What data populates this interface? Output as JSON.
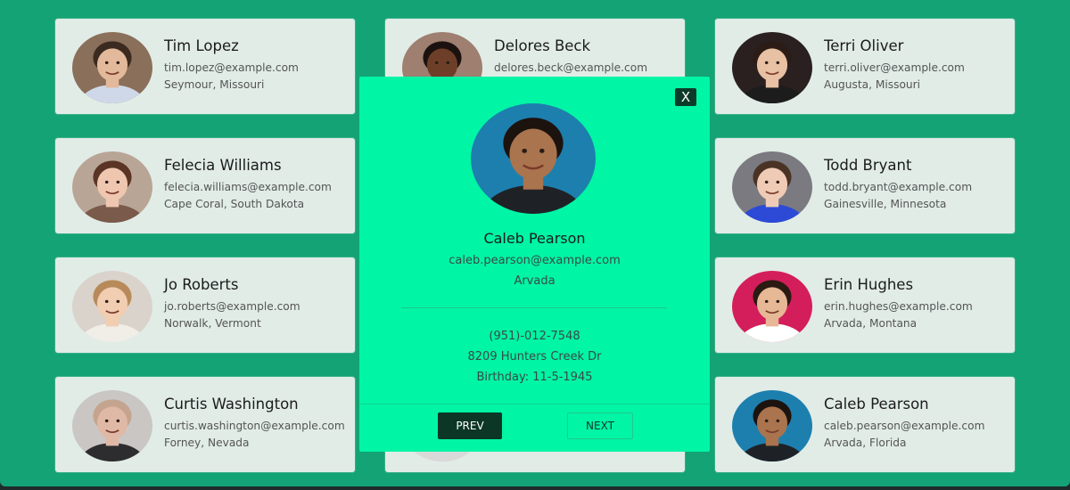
{
  "cards": [
    {
      "name": "Tim Lopez",
      "email": "tim.lopez@example.com",
      "location": "Seymour, Missouri",
      "skin": "#e2b99a",
      "hair": "#3b2a1f",
      "bg": "#8a6f5a",
      "shirt": "#cfd8e8"
    },
    {
      "name": "Delores Beck",
      "email": "delores.beck@example.com",
      "location": "",
      "skin": "#6e3f28",
      "hair": "#1b1210",
      "bg": "#9e7f70",
      "shirt": "#2b2b2b"
    },
    {
      "name": "Terri Oliver",
      "email": "terri.oliver@example.com",
      "location": "Augusta, Missouri",
      "skin": "#e8c0a4",
      "hair": "#2b1c16",
      "bg": "#2a2020",
      "shirt": "#1c1c1c"
    },
    {
      "name": "Felecia Williams",
      "email": "felecia.williams@example.com",
      "location": "Cape Coral, South Dakota",
      "skin": "#efc7b0",
      "hair": "#5a3424",
      "bg": "#b9a596",
      "shirt": "#7a5a4a"
    },
    {
      "name": "Todd Bryant",
      "email": "todd.bryant@example.com",
      "location": "Gainesville, Minnesota",
      "skin": "#efcbb6",
      "hair": "#4a3324",
      "bg": "#7a7a80",
      "shirt": "#2c4ad6"
    },
    {
      "name": "Jo Roberts",
      "email": "jo.roberts@example.com",
      "location": "Norwalk, Vermont",
      "skin": "#f1cdb2",
      "hair": "#b88a5a",
      "bg": "#d9d3cb",
      "shirt": "#f1eee8"
    },
    {
      "name": "Erin Hughes",
      "email": "erin.hughes@example.com",
      "location": "Arvada, Montana",
      "skin": "#e6b895",
      "hair": "#2a1a12",
      "bg": "#d41e5c",
      "shirt": "#ffffff"
    },
    {
      "name": "Curtis Washington",
      "email": "curtis.washington@example.com",
      "location": "Forney, Nevada",
      "skin": "#e0b8a6",
      "hair": "#c4a48e",
      "bg": "#c9c6c3",
      "shirt": "#2d2d30"
    },
    {
      "name": "",
      "email": "",
      "location": "",
      "skin": "#e8c9b6",
      "hair": "#2a1a14",
      "bg": "#d1cbc5",
      "shirt": "#d9d9d9"
    },
    {
      "name": "Caleb Pearson",
      "email": "caleb.pearson@example.com",
      "location": "Arvada, Florida",
      "skin": "#a9744e",
      "hair": "#1c130f",
      "bg": "#1d7fae",
      "shirt": "#1e2226"
    }
  ],
  "modal": {
    "close_label": "X",
    "name": "Caleb Pearson",
    "email": "caleb.pearson@example.com",
    "city": "Arvada",
    "phone": "(951)-012-7548",
    "address": "8209 Hunters Creek Dr",
    "birthday": "Birthday: 11-5-1945",
    "prev_label": "PREV",
    "next_label": "NEXT",
    "skin": "#a9744e",
    "hair": "#1c130f",
    "bg": "#1d7fae",
    "shirt": "#1e2226"
  },
  "colors": {
    "background": "#14a374",
    "card": "#e1ece7",
    "modal": "#00f5a4",
    "button_dark": "#0c3626"
  }
}
